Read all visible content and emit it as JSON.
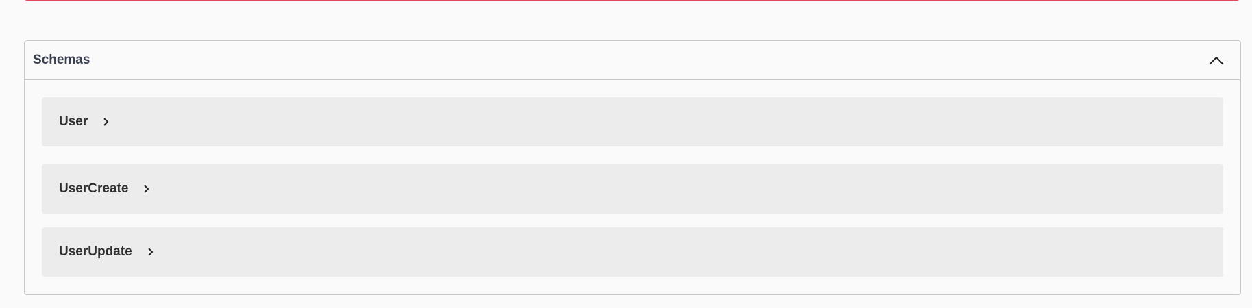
{
  "schemas": {
    "title": "Schemas",
    "toggle_icon": "chevron-up-icon",
    "models": [
      {
        "name": "User",
        "icon": "chevron-right-icon"
      },
      {
        "name": "UserCreate",
        "icon": "chevron-right-icon"
      },
      {
        "name": "UserUpdate",
        "icon": "chevron-right-icon"
      }
    ]
  },
  "colors": {
    "background": "#fafafa",
    "section_border": "#c8c8c8",
    "model_row_bg": "#ececec",
    "top_card_border": "#e64855",
    "title_text": "#3b4151",
    "model_text": "#303030"
  }
}
